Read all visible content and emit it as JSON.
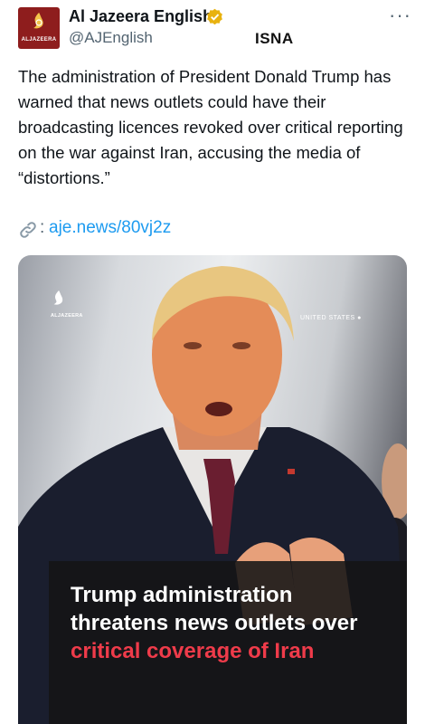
{
  "account": {
    "display_name": "Al Jazeera English",
    "handle": "@AJEnglish",
    "avatar_text": "ALJAZEERA",
    "verified": true
  },
  "watermark": "ISNA",
  "more_label": "···",
  "tweet": {
    "text": "The administration of President Donald Trump has warned that news outlets could have their broadcasting licences revoked over critical reporting on the war against Iran, accusing the media of “distortions.”",
    "link_colon": ":",
    "link_url": "aje.news/80vj2z"
  },
  "media": {
    "logo_text": "ALJAZEERA",
    "location": "UNITED STATES",
    "headline_part1": "Trump administration threatens news outlets over ",
    "headline_highlight": "critical coverage of Iran"
  },
  "colors": {
    "link": "#1d9bf0",
    "highlight": "#ef3b4a",
    "verified_badge": "#e8b20f",
    "avatar_bg": "#8e1d1d"
  }
}
